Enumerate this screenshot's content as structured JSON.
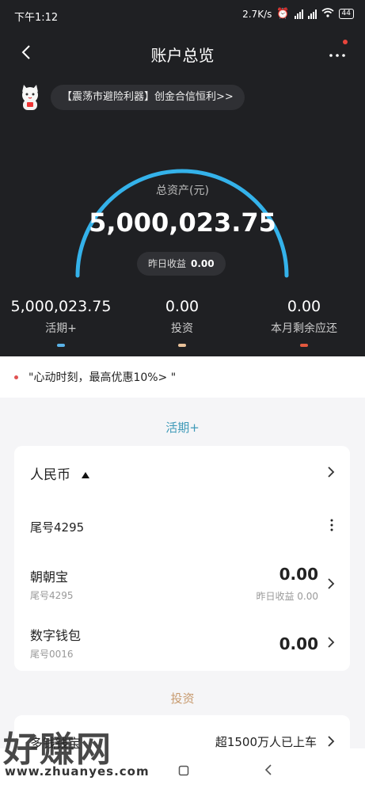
{
  "status_bar": {
    "time": "下午1:12",
    "speed": "2.7K/s",
    "battery": "44"
  },
  "header": {
    "title": "账户总览"
  },
  "notice": {
    "text": "【震荡市避险利器】创金合信恒利>>"
  },
  "summary": {
    "total_label": "总资产(元)",
    "total_value": "5,000,023.75",
    "yesterday_label": "昨日收益",
    "yesterday_value": "0.00",
    "stats": [
      {
        "value": "5,000,023.75",
        "label": "活期+",
        "color": "#5ab3e8"
      },
      {
        "value": "0.00",
        "label": "投资",
        "color": "#e9c29a"
      },
      {
        "value": "0.00",
        "label": "本月剩余应还",
        "color": "#e2583e"
      }
    ]
  },
  "promo": {
    "text": "\"心动时刻，最高优惠10%> \""
  },
  "huoqi": {
    "title": "活期+",
    "currency": "人民币",
    "account_tail": "尾号4295",
    "items": [
      {
        "name": "朝朝宝",
        "tail": "尾号4295",
        "amount": "0.00",
        "sub": "昨日收益 0.00"
      },
      {
        "name": "数字钱包",
        "tail": "尾号0016",
        "amount": "0.00"
      }
    ]
  },
  "investment": {
    "title": "投资",
    "partial_label": "多钱钱宝",
    "right_text": "超1500万人已上车"
  },
  "watermark": {
    "brand": "好赚网",
    "url": "www.zhuanyes.com"
  }
}
